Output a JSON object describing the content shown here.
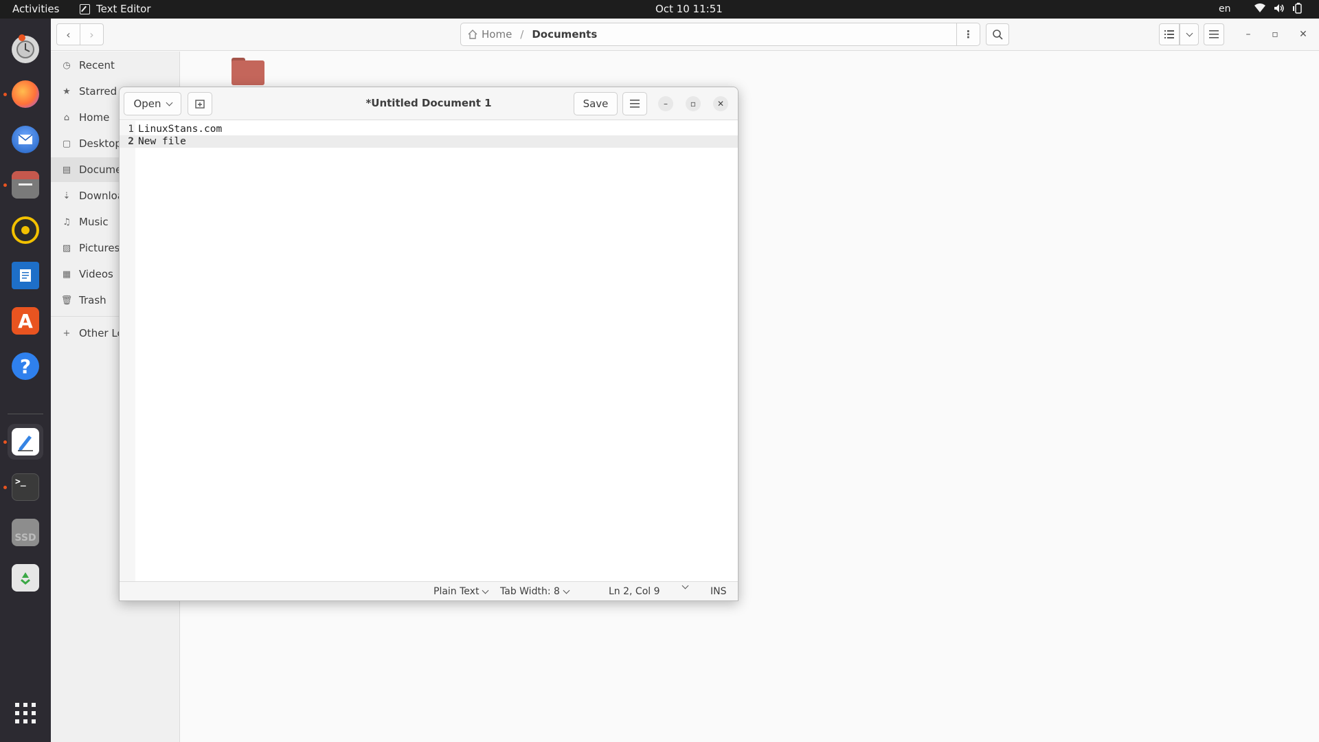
{
  "topbar": {
    "activities": "Activities",
    "app_name": "Text Editor",
    "clock": "Oct 10  11:51",
    "language": "en"
  },
  "dock": {
    "items": [
      {
        "name": "Ubuntu Software Updater",
        "icon": "updater-icon"
      },
      {
        "name": "Firefox",
        "icon": "firefox-icon"
      },
      {
        "name": "Thunderbird",
        "icon": "thunderbird-icon"
      },
      {
        "name": "Files",
        "icon": "files-icon"
      },
      {
        "name": "Rhythmbox",
        "icon": "rhythmbox-icon"
      },
      {
        "name": "LibreOffice Writer",
        "icon": "writer-icon"
      },
      {
        "name": "Ubuntu Software",
        "icon": "software-center-icon"
      },
      {
        "name": "Help",
        "icon": "help-icon"
      },
      {
        "name": "Text Editor",
        "icon": "text-editor-icon"
      },
      {
        "name": "Terminal",
        "icon": "terminal-icon"
      },
      {
        "name": "SSD drive",
        "icon": "drive-icon",
        "label": "SSD"
      },
      {
        "name": "Trash",
        "icon": "trash-icon"
      }
    ],
    "apps_grid": "show-applications-icon"
  },
  "files": {
    "path": {
      "home": "Home",
      "separator": "/",
      "current": "Documents"
    },
    "sidebar": [
      {
        "label": "Recent",
        "icon": "clock-icon"
      },
      {
        "label": "Starred",
        "icon": "star-icon"
      },
      {
        "label": "Home",
        "icon": "home-icon"
      },
      {
        "label": "Desktop",
        "icon": "desktop-icon"
      },
      {
        "label": "Documen",
        "icon": "document-icon"
      },
      {
        "label": "Downloac",
        "icon": "download-icon"
      },
      {
        "label": "Music",
        "icon": "music-icon"
      },
      {
        "label": "Pictures",
        "icon": "pictures-icon"
      },
      {
        "label": "Videos",
        "icon": "videos-icon"
      },
      {
        "label": "Trash",
        "icon": "trash-icon"
      },
      {
        "label": "Other Loc",
        "icon": "plus-icon"
      }
    ]
  },
  "editor": {
    "title": "*Untitled Document 1",
    "open_label": "Open",
    "save_label": "Save",
    "lines": [
      {
        "num": "1",
        "text": "LinuxStans.com"
      },
      {
        "num": "2",
        "text": "New file"
      }
    ],
    "status": {
      "language": "Plain Text",
      "tab_width": "Tab Width: 8",
      "position": "Ln 2, Col 9",
      "mode": "INS"
    }
  },
  "colors": {
    "topbar": "#1d1d1d",
    "dock": "#2c2a31",
    "accent": "#e95420",
    "folder": "#c4665b"
  }
}
